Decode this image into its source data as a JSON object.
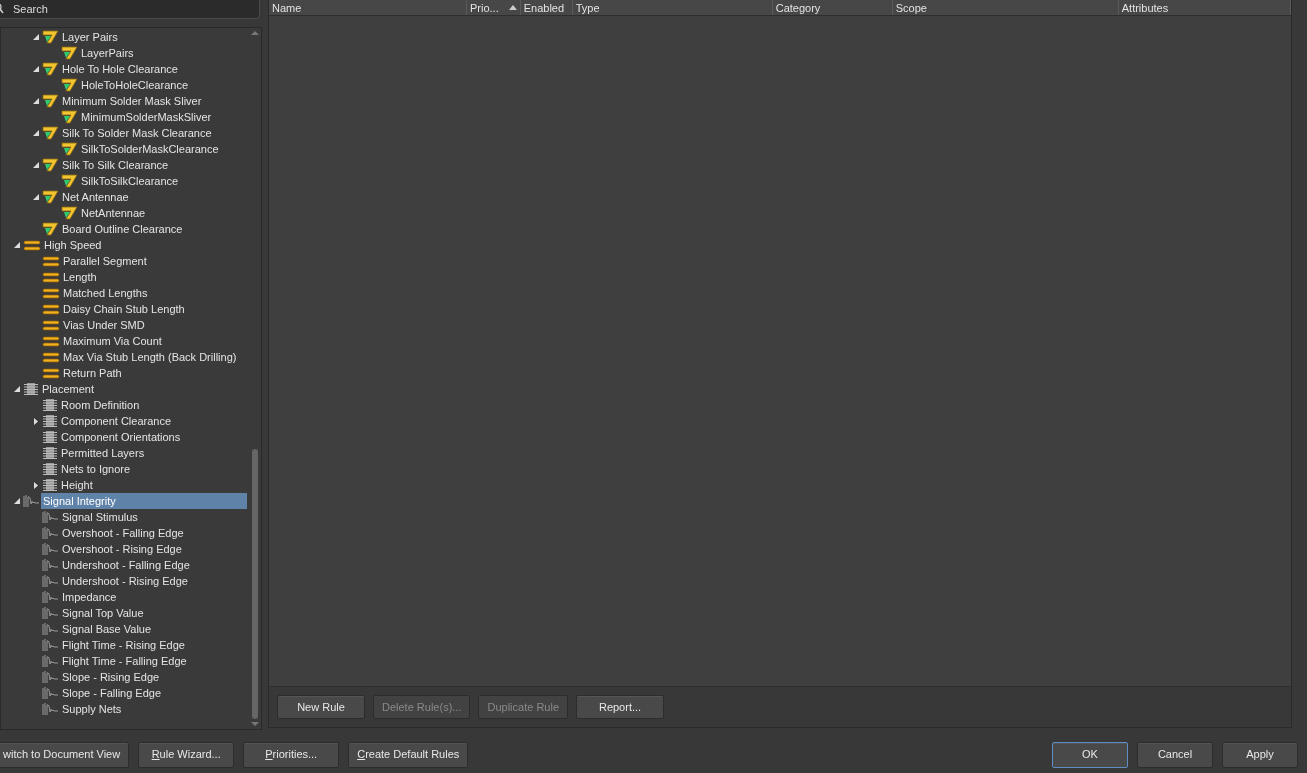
{
  "search": {
    "placeholder": "Search"
  },
  "tree": {
    "items": [
      {
        "children": [
          {
            "label": "Layer Pairs",
            "kind": "manufacturing",
            "selected": false,
            "expanded": true,
            "children": [
              {
                "label": "LayerPairs",
                "kind": "manufacturing",
                "selected": false
              }
            ]
          },
          {
            "label": "Hole To Hole Clearance",
            "kind": "manufacturing",
            "selected": false,
            "expanded": true,
            "children": [
              {
                "label": "HoleToHoleClearance",
                "kind": "manufacturing",
                "selected": false
              }
            ]
          },
          {
            "label": "Minimum Solder Mask Sliver",
            "kind": "manufacturing",
            "selected": false,
            "expanded": true,
            "children": [
              {
                "label": "MinimumSolderMaskSliver",
                "kind": "manufacturing",
                "selected": false
              }
            ]
          },
          {
            "label": "Silk To Solder Mask Clearance",
            "kind": "manufacturing",
            "selected": false,
            "expanded": true,
            "children": [
              {
                "label": "SilkToSolderMaskClearance",
                "kind": "manufacturing",
                "selected": false
              }
            ]
          },
          {
            "label": "Silk To Silk Clearance",
            "kind": "manufacturing",
            "selected": false,
            "expanded": true,
            "children": [
              {
                "label": "SilkToSilkClearance",
                "kind": "manufacturing",
                "selected": false
              }
            ]
          },
          {
            "label": "Net Antennae",
            "kind": "manufacturing",
            "selected": false,
            "expanded": true,
            "children": [
              {
                "label": "NetAntennae",
                "kind": "manufacturing",
                "selected": false
              }
            ]
          },
          {
            "label": "Board Outline Clearance",
            "kind": "manufacturing",
            "selected": false
          }
        ]
      },
      {
        "label": "High Speed",
        "kind": "high-speed",
        "selected": false,
        "expanded": true,
        "children": [
          {
            "label": "Parallel Segment",
            "kind": "high-speed",
            "selected": false
          },
          {
            "label": "Length",
            "kind": "high-speed",
            "selected": false
          },
          {
            "label": "Matched Lengths",
            "kind": "high-speed",
            "selected": false
          },
          {
            "label": "Daisy Chain Stub Length",
            "kind": "high-speed",
            "selected": false
          },
          {
            "label": "Vias Under SMD",
            "kind": "high-speed",
            "selected": false
          },
          {
            "label": "Maximum Via Count",
            "kind": "high-speed",
            "selected": false
          },
          {
            "label": "Max Via Stub Length (Back Drilling)",
            "kind": "high-speed",
            "selected": false
          },
          {
            "label": "Return Path",
            "kind": "high-speed",
            "selected": false
          }
        ]
      },
      {
        "label": "Placement",
        "kind": "placement",
        "selected": false,
        "expanded": true,
        "children": [
          {
            "label": "Room Definition",
            "kind": "placement",
            "selected": false
          },
          {
            "label": "Component Clearance",
            "kind": "placement",
            "selected": false,
            "expanded": false
          },
          {
            "label": "Component Orientations",
            "kind": "placement",
            "selected": false
          },
          {
            "label": "Permitted Layers",
            "kind": "placement",
            "selected": false
          },
          {
            "label": "Nets to Ignore",
            "kind": "placement",
            "selected": false
          },
          {
            "label": "Height",
            "kind": "placement",
            "selected": false,
            "expanded": false
          }
        ]
      },
      {
        "label": "Signal Integrity",
        "kind": "signal-integrity",
        "selected": true,
        "expanded": true,
        "children": [
          {
            "label": "Signal Stimulus",
            "kind": "signal-integrity",
            "selected": false
          },
          {
            "label": "Overshoot - Falling Edge",
            "kind": "signal-integrity",
            "selected": false
          },
          {
            "label": "Overshoot - Rising Edge",
            "kind": "signal-integrity",
            "selected": false
          },
          {
            "label": "Undershoot - Falling Edge",
            "kind": "signal-integrity",
            "selected": false
          },
          {
            "label": "Undershoot - Rising Edge",
            "kind": "signal-integrity",
            "selected": false
          },
          {
            "label": "Impedance",
            "kind": "signal-integrity",
            "selected": false
          },
          {
            "label": "Signal Top Value",
            "kind": "signal-integrity",
            "selected": false
          },
          {
            "label": "Signal Base Value",
            "kind": "signal-integrity",
            "selected": false
          },
          {
            "label": "Flight Time - Rising Edge",
            "kind": "signal-integrity",
            "selected": false
          },
          {
            "label": "Flight Time - Falling Edge",
            "kind": "signal-integrity",
            "selected": false
          },
          {
            "label": "Slope - Rising Edge",
            "kind": "signal-integrity",
            "selected": false
          },
          {
            "label": "Slope - Falling Edge",
            "kind": "signal-integrity",
            "selected": false
          },
          {
            "label": "Supply Nets",
            "kind": "signal-integrity",
            "selected": false
          }
        ]
      }
    ]
  },
  "table": {
    "columns": [
      {
        "label": "Name",
        "sorted": false
      },
      {
        "label": "Prio...",
        "sorted": true
      },
      {
        "label": "Enabled",
        "sorted": false
      },
      {
        "label": "Type",
        "sorted": false
      },
      {
        "label": "Category",
        "sorted": false
      },
      {
        "label": "Scope",
        "sorted": false
      },
      {
        "label": "Attributes",
        "sorted": false
      }
    ]
  },
  "rule_buttons": [
    {
      "label": "New Rule",
      "disabled": false
    },
    {
      "label": "Delete Rule(s)...",
      "disabled": true
    },
    {
      "label": "Duplicate Rule",
      "disabled": true
    },
    {
      "label": "Report...",
      "disabled": false
    }
  ],
  "footer_left_buttons": [
    {
      "label": "witch to Document View",
      "mnemonic": false
    },
    {
      "label": "Rule Wizard...",
      "mnemonic": true
    },
    {
      "label": "Priorities...",
      "mnemonic": true
    },
    {
      "label": "Create Default Rules",
      "mnemonic": true
    }
  ],
  "footer_right_buttons": [
    {
      "label": "OK",
      "default": true
    },
    {
      "label": "Cancel",
      "default": false
    },
    {
      "label": "Apply",
      "default": false
    }
  ]
}
